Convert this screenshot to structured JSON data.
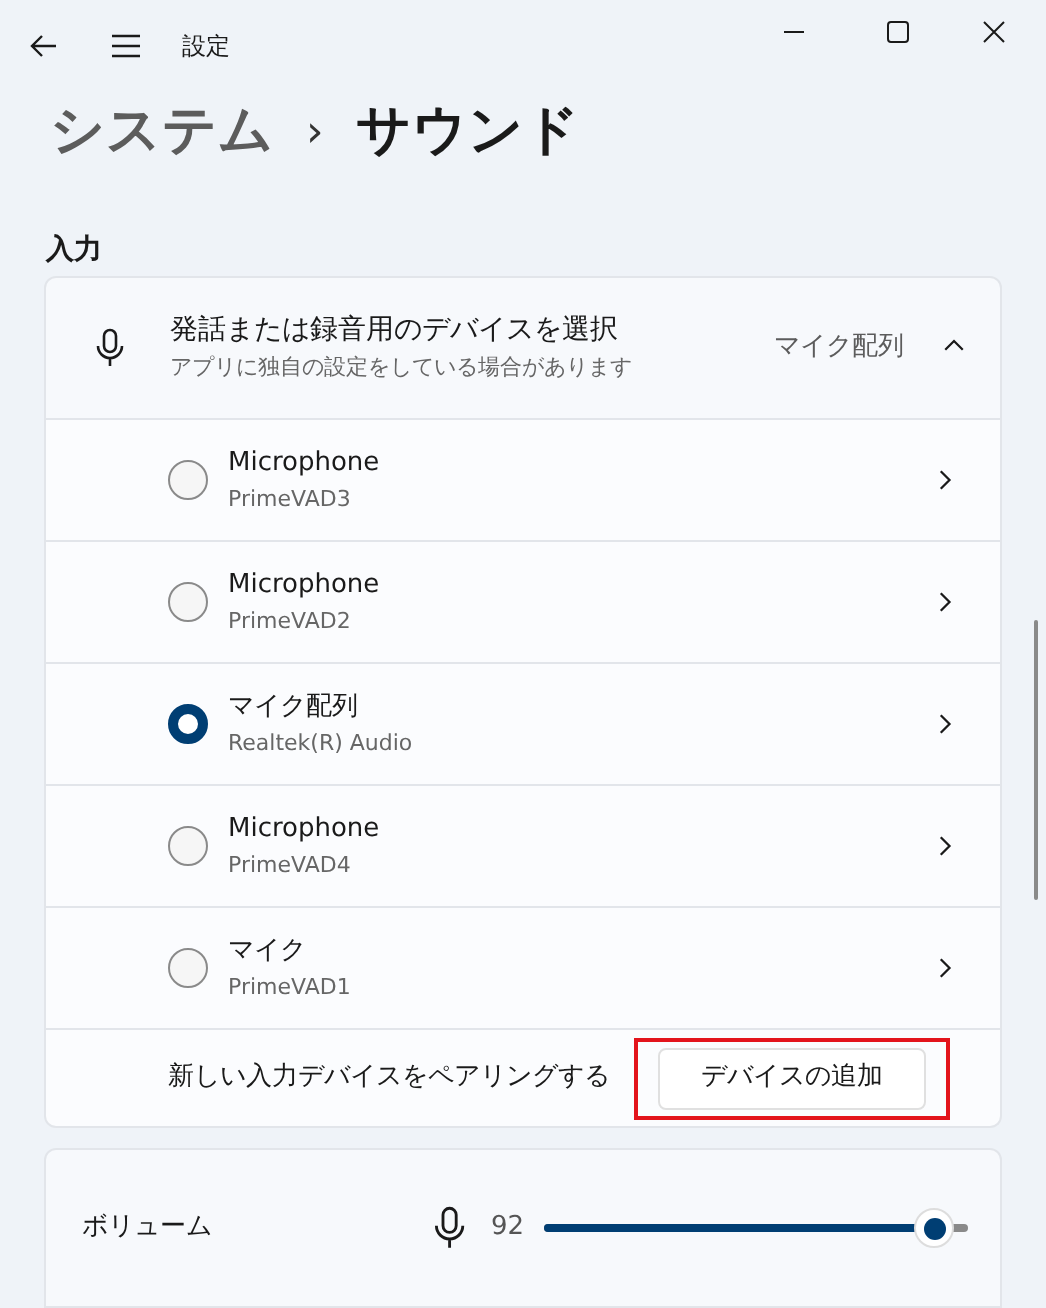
{
  "window": {
    "title": "設定"
  },
  "breadcrumb": {
    "parent": "システム",
    "separator": "›",
    "current": "サウンド"
  },
  "section": {
    "title": "入力"
  },
  "input_device": {
    "title": "発話または録音用のデバイスを選択",
    "subtitle": "アプリに独自の設定をしている場合があります",
    "value": "マイク配列",
    "expanded": true,
    "devices": [
      {
        "name": "Microphone",
        "detail": "PrimeVAD3",
        "selected": false
      },
      {
        "name": "Microphone",
        "detail": "PrimeVAD2",
        "selected": false
      },
      {
        "name": "マイク配列",
        "detail": "Realtek(R) Audio",
        "selected": true
      },
      {
        "name": "Microphone",
        "detail": "PrimeVAD4",
        "selected": false
      },
      {
        "name": "マイク",
        "detail": "PrimeVAD1",
        "selected": false
      }
    ],
    "pair": {
      "label": "新しい入力デバイスをペアリングする",
      "button": "デバイスの追加",
      "highlighted": true
    }
  },
  "volume": {
    "label": "ボリューム",
    "reading": "92",
    "level": 0.92
  }
}
